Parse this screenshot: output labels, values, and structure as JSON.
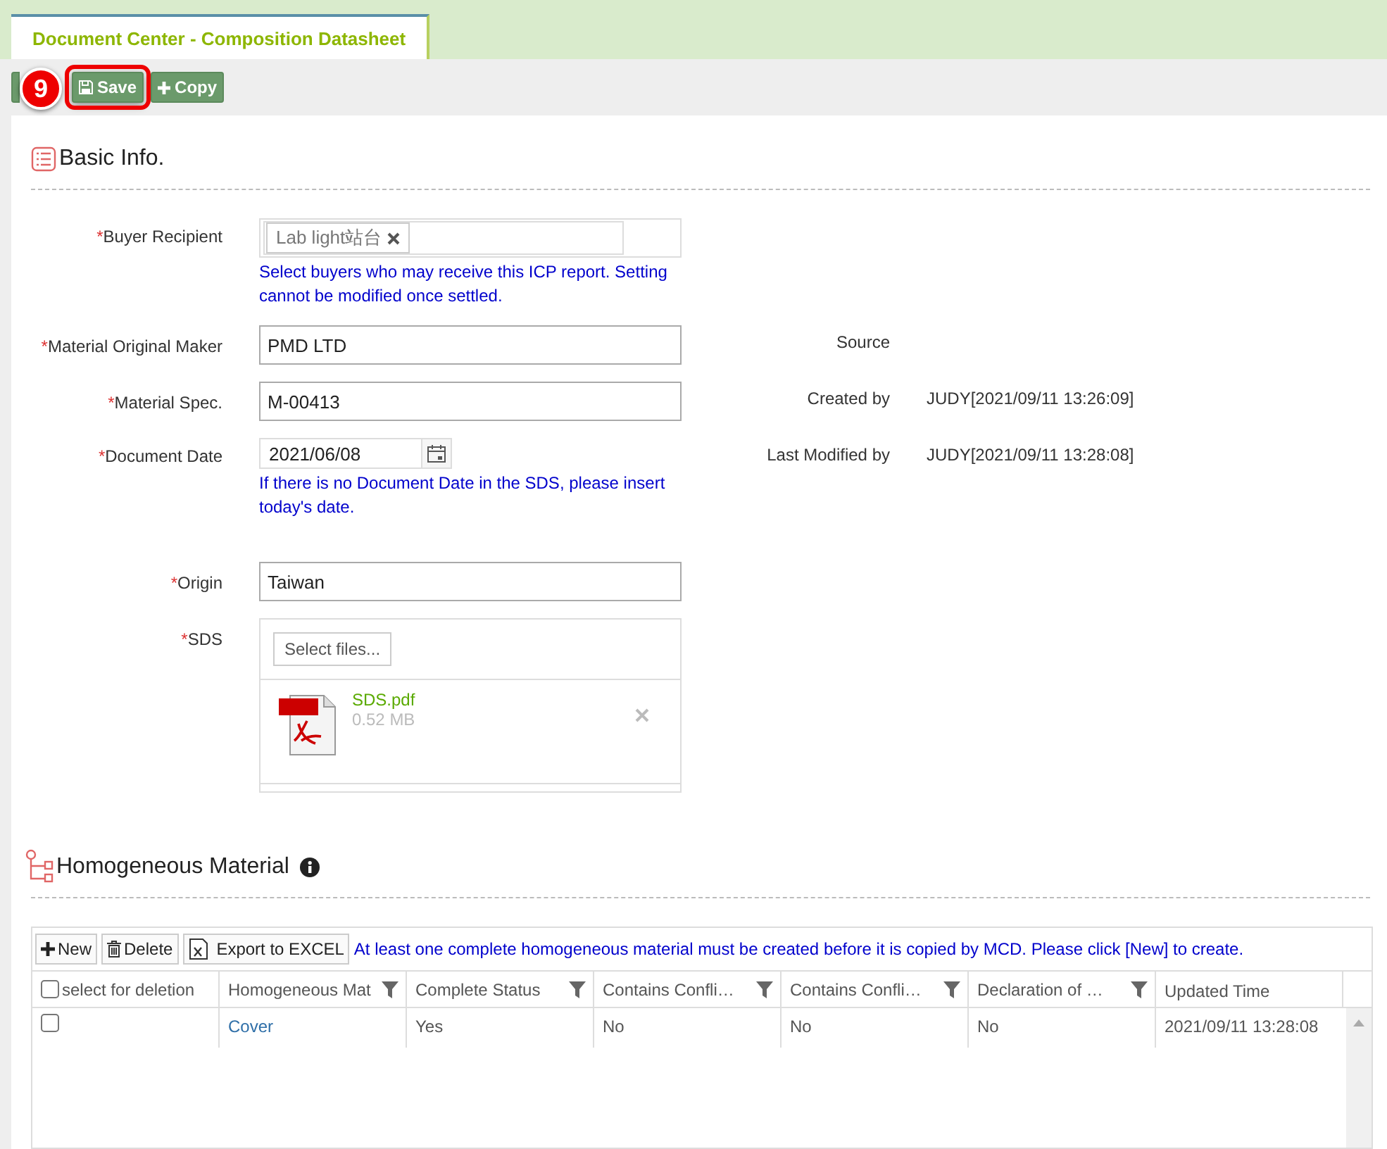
{
  "tab": {
    "label": "Document Center - Composition Datasheet",
    "selected": true
  },
  "step_badge": "9",
  "toolbar": [
    {
      "kind": "hidden"
    },
    {
      "kind": "save",
      "label": "Save",
      "highlighted": true
    },
    {
      "kind": "copy",
      "label": "Copy",
      "highlighted": false
    }
  ],
  "basic_info": {
    "title": "Basic Info.",
    "fields": [
      {
        "kind": "tags",
        "label": "Buyer Recipient",
        "required_mark": "*",
        "tags": [
          "Lab light站台"
        ],
        "hint": "Select buyers who may receive this ICP report. Setting cannot be modified once settled."
      },
      {
        "kind": "text",
        "label": "Material Original Maker",
        "required_mark": "*",
        "value": "PMD LTD"
      },
      {
        "kind": "text",
        "label": "Material Spec.",
        "required_mark": "*",
        "value": "M-00413"
      },
      {
        "kind": "date",
        "label": "Document Date",
        "required_mark": "*",
        "value": "2021/06/08",
        "hint": "If there is no Document Date in the SDS, please insert today's date."
      },
      {
        "kind": "text",
        "label": "Origin",
        "required_mark": "*",
        "value": "Taiwan"
      },
      {
        "kind": "upload",
        "label": "SDS",
        "required_mark": "*",
        "button": "Select files...",
        "files": [
          {
            "name": "SDS.pdf",
            "size": "0.52 MB"
          }
        ]
      }
    ],
    "info": [
      {
        "label": "Source"
      },
      {
        "label": "Created by",
        "value": "JUDY[2021/09/11 13:26:09]"
      },
      {
        "label": "Last Modified by",
        "value": "JUDY[2021/09/11 13:28:08]"
      }
    ]
  },
  "homogeneous": {
    "title": "Homogeneous Material",
    "toolbar": [
      {
        "kind": "new",
        "label": "New"
      },
      {
        "kind": "delete",
        "label": "Delete"
      },
      {
        "kind": "excel",
        "label": "Export to EXCEL"
      }
    ],
    "notice": "At least one complete homogeneous material must be created before it is copied by MCD. Please click [New] to create.",
    "columns": [
      {
        "kind": "check",
        "label": "select for deletion",
        "checked": false
      },
      {
        "kind": "filter",
        "label": "Homogeneous Mat"
      },
      {
        "kind": "filter",
        "label": "Complete Status"
      },
      {
        "kind": "filter",
        "label": "Contains Confli…"
      },
      {
        "kind": "filter",
        "label": "Contains Confli…"
      },
      {
        "kind": "filter",
        "label": "Declaration of …"
      },
      {
        "kind": "plain",
        "label": "Updated Time"
      }
    ],
    "rows": [
      {
        "checked": false,
        "cells": [
          "",
          "Cover",
          "Yes",
          "No",
          "No",
          "No",
          "2021/09/11 13:28:08"
        ]
      }
    ]
  }
}
